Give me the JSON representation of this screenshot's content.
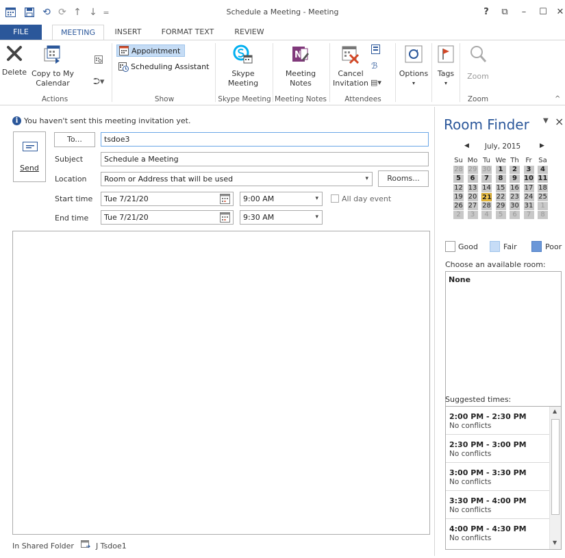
{
  "window": {
    "title": "Schedule a Meeting - Meeting",
    "controls": [
      "?",
      "⧉",
      "–",
      "☐",
      "✕"
    ]
  },
  "quick_access": {
    "save": "save-icon",
    "undo": "undo-icon",
    "redo": "redo-icon",
    "up": "up-arrow-icon",
    "down": "down-arrow-icon",
    "customize": "customize-icon"
  },
  "tabs": [
    {
      "label": "FILE"
    },
    {
      "label": "MEETING"
    },
    {
      "label": "INSERT"
    },
    {
      "label": "FORMAT TEXT"
    },
    {
      "label": "REVIEW"
    }
  ],
  "ribbon": {
    "actions": {
      "delete": "Delete",
      "copy_line1": "Copy to My",
      "copy_line2": "Calendar",
      "group": "Actions"
    },
    "show": {
      "appointment": "Appointment",
      "scheduling": "Scheduling Assistant",
      "group": "Show"
    },
    "skype": {
      "line1": "Skype",
      "line2": "Meeting",
      "group": "Skype Meeting"
    },
    "notes": {
      "line1": "Meeting",
      "line2": "Notes",
      "group": "Meeting Notes"
    },
    "attendees": {
      "line1": "Cancel",
      "line2": "Invitation",
      "group": "Attendees"
    },
    "options": {
      "label": "Options"
    },
    "tags": {
      "label": "Tags"
    },
    "zoom": {
      "label": "Zoom",
      "group": "Zoom"
    }
  },
  "info": {
    "text": "You haven't sent this meeting invitation yet."
  },
  "form": {
    "send_label": "Send",
    "to_button": "To...",
    "to_value": "tsdoe3",
    "subject_label": "Subject",
    "subject_value": "Schedule a Meeting",
    "location_label": "Location",
    "location_value": "Room or Address that will be used",
    "rooms_button": "Rooms...",
    "start_label": "Start time",
    "start_date": "Tue 7/21/20",
    "start_time": "9:00 AM",
    "allday_label": "All day event",
    "end_label": "End time",
    "end_date": "Tue 7/21/20",
    "end_time": "9:30 AM"
  },
  "footer": {
    "folder_label": "In Shared Folder",
    "owner": "J Tsdoe1"
  },
  "room_finder": {
    "title": "Room Finder",
    "month": "July, 2015",
    "weekdays": [
      "Su",
      "Mo",
      "Tu",
      "We",
      "Th",
      "Fr",
      "Sa"
    ],
    "weeks": [
      [
        "28",
        "29",
        "30",
        "1",
        "2",
        "3",
        "4"
      ],
      [
        "5",
        "6",
        "7",
        "8",
        "9",
        "10",
        "11"
      ],
      [
        "12",
        "13",
        "14",
        "15",
        "16",
        "17",
        "18"
      ],
      [
        "19",
        "20",
        "21",
        "22",
        "23",
        "24",
        "25"
      ],
      [
        "26",
        "27",
        "28",
        "29",
        "30",
        "31",
        "1"
      ],
      [
        "2",
        "3",
        "4",
        "5",
        "6",
        "7",
        "8"
      ]
    ],
    "selected_day": "21",
    "legend": {
      "good": "Good",
      "fair": "Fair",
      "poor": "Poor"
    },
    "choose_label": "Choose an available room:",
    "rooms": [
      "None"
    ],
    "suggested_label": "Suggested times:",
    "suggestions": [
      {
        "time": "2:00 PM - 2:30 PM",
        "status": "No conflicts"
      },
      {
        "time": "2:30 PM - 3:00 PM",
        "status": "No conflicts"
      },
      {
        "time": "3:00 PM - 3:30 PM",
        "status": "No conflicts"
      },
      {
        "time": "3:30 PM - 4:00 PM",
        "status": "No conflicts"
      },
      {
        "time": "4:00 PM - 4:30 PM",
        "status": "No conflicts"
      }
    ]
  },
  "colors": {
    "accent": "#2b579a",
    "good": "#ffffff",
    "fair": "#c6dcf6",
    "poor": "#6b97d8",
    "selected_day": "#f5c84c"
  }
}
